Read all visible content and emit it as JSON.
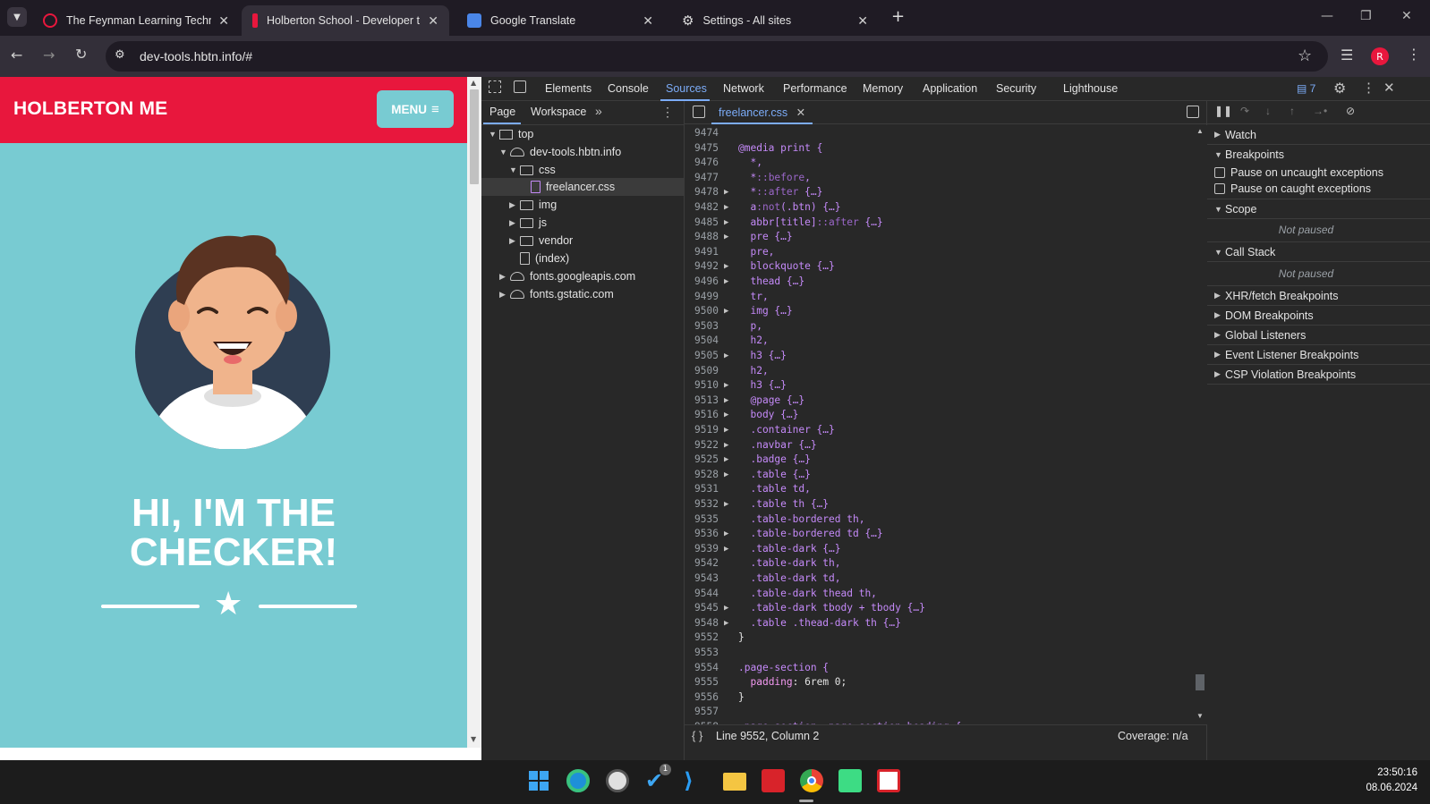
{
  "browser": {
    "tabs": [
      {
        "title": "The Feynman Learning Techniqu",
        "active": false
      },
      {
        "title": "Holberton School - Developer t",
        "active": true
      },
      {
        "title": "Google Translate",
        "active": false
      },
      {
        "title": "Settings - All sites",
        "active": false
      }
    ],
    "url": "dev-tools.hbtn.info/#",
    "profile_initial": "R"
  },
  "page": {
    "brand": "HOLBERTON ME",
    "menu_label": "MENU",
    "hero_line1": "HI, I'M THE",
    "hero_line2": "CHECKER!"
  },
  "devtools": {
    "tabs": [
      "Elements",
      "Console",
      "Sources",
      "Network",
      "Performance",
      "Memory",
      "Application",
      "Security",
      "Lighthouse"
    ],
    "selected_tab": "Sources",
    "issues_count": "7",
    "navigator_tabs": [
      "Page",
      "Workspace"
    ],
    "tree": {
      "top": "top",
      "host": "dev-tools.hbtn.info",
      "css": "css",
      "file": "freelancer.css",
      "img": "img",
      "js": "js",
      "vendor": "vendor",
      "index": "(index)",
      "host2": "fonts.googleapis.com",
      "host3": "fonts.gstatic.com"
    },
    "open_file": "freelancer.css",
    "code_lines": [
      {
        "n": "9474",
        "t": "",
        "fold": false
      },
      {
        "n": "9475",
        "t": "@media print {",
        "fold": false
      },
      {
        "n": "9476",
        "t": "  *,",
        "fold": false
      },
      {
        "n": "9477",
        "t": "  *::before,",
        "fold": false
      },
      {
        "n": "9478",
        "t": "  *::after {…}",
        "fold": true
      },
      {
        "n": "9482",
        "t": "  a:not(.btn) {…}",
        "fold": true
      },
      {
        "n": "9485",
        "t": "  abbr[title]::after {…}",
        "fold": true
      },
      {
        "n": "9488",
        "t": "  pre {…}",
        "fold": true
      },
      {
        "n": "9491",
        "t": "  pre,",
        "fold": false
      },
      {
        "n": "9492",
        "t": "  blockquote {…}",
        "fold": true
      },
      {
        "n": "9496",
        "t": "  thead {…}",
        "fold": true
      },
      {
        "n": "9499",
        "t": "  tr,",
        "fold": false
      },
      {
        "n": "9500",
        "t": "  img {…}",
        "fold": true
      },
      {
        "n": "9503",
        "t": "  p,",
        "fold": false
      },
      {
        "n": "9504",
        "t": "  h2,",
        "fold": false
      },
      {
        "n": "9505",
        "t": "  h3 {…}",
        "fold": true
      },
      {
        "n": "9509",
        "t": "  h2,",
        "fold": false
      },
      {
        "n": "9510",
        "t": "  h3 {…}",
        "fold": true
      },
      {
        "n": "9513",
        "t": "  @page {…}",
        "fold": true
      },
      {
        "n": "9516",
        "t": "  body {…}",
        "fold": true
      },
      {
        "n": "9519",
        "t": "  .container {…}",
        "fold": true
      },
      {
        "n": "9522",
        "t": "  .navbar {…}",
        "fold": true
      },
      {
        "n": "9525",
        "t": "  .badge {…}",
        "fold": true
      },
      {
        "n": "9528",
        "t": "  .table {…}",
        "fold": true
      },
      {
        "n": "9531",
        "t": "  .table td,",
        "fold": false
      },
      {
        "n": "9532",
        "t": "  .table th {…}",
        "fold": true
      },
      {
        "n": "9535",
        "t": "  .table-bordered th,",
        "fold": false
      },
      {
        "n": "9536",
        "t": "  .table-bordered td {…}",
        "fold": true
      },
      {
        "n": "9539",
        "t": "  .table-dark {…}",
        "fold": true
      },
      {
        "n": "9542",
        "t": "  .table-dark th,",
        "fold": false
      },
      {
        "n": "9543",
        "t": "  .table-dark td,",
        "fold": false
      },
      {
        "n": "9544",
        "t": "  .table-dark thead th,",
        "fold": false
      },
      {
        "n": "9545",
        "t": "  .table-dark tbody + tbody {…}",
        "fold": true
      },
      {
        "n": "9548",
        "t": "  .table .thead-dark th {…}",
        "fold": true
      },
      {
        "n": "9552",
        "t": "}",
        "fold": false
      },
      {
        "n": "9553",
        "t": "",
        "fold": false
      },
      {
        "n": "9554",
        "t": ".page-section {",
        "fold": false
      },
      {
        "n": "9555",
        "t": "  padding: 6rem 0;",
        "fold": false
      },
      {
        "n": "9556",
        "t": "}",
        "fold": false
      },
      {
        "n": "9557",
        "t": "",
        "fold": false
      },
      {
        "n": "9558",
        "t": ".page-section .page-section-heading {",
        "fold": false
      }
    ],
    "status": "Line 9552, Column 2",
    "coverage": "Coverage: n/a",
    "debugger": {
      "watch": "Watch",
      "breakpoints": "Breakpoints",
      "pause_uncaught": "Pause on uncaught exceptions",
      "pause_caught": "Pause on caught exceptions",
      "scope": "Scope",
      "not_paused": "Not paused",
      "call_stack": "Call Stack",
      "xhr": "XHR/fetch Breakpoints",
      "dom": "DOM Breakpoints",
      "global": "Global Listeners",
      "event": "Event Listener Breakpoints",
      "csp": "CSP Violation Breakpoints"
    }
  },
  "taskbar": {
    "time": "23:50:16",
    "date": "08.06.2024",
    "todo_badge": "1"
  },
  "colors": {
    "brand_red": "#e8173d",
    "page_teal": "#78cbd2",
    "devtools_accent": "#7cacf8"
  }
}
